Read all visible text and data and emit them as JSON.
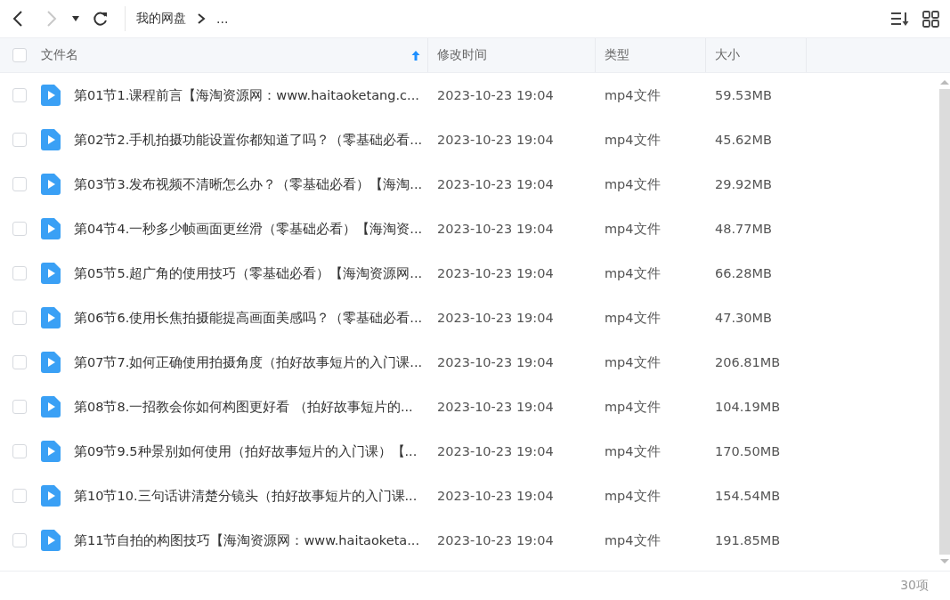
{
  "toolbar": {
    "back": {
      "disabled": false
    },
    "forward": {
      "disabled": true
    },
    "breadcrumb": [
      {
        "label": "我的网盘"
      },
      {
        "label": "..."
      }
    ]
  },
  "table": {
    "header_checkbox": {
      "checked": false
    },
    "columns": [
      {
        "label": "文件名",
        "sorted": true
      },
      {
        "label": "修改时间",
        "sorted": false
      },
      {
        "label": "类型",
        "sorted": false
      },
      {
        "label": "大小",
        "sorted": false
      }
    ],
    "rows": [
      {
        "checked": false,
        "name": "第01节1.课程前言【海淘资源网：www.haitaoketang.c...",
        "modified": "2023-10-23 19:04",
        "type": "mp4文件",
        "size": "59.53MB"
      },
      {
        "checked": false,
        "name": "第02节2.手机拍摄功能设置你都知道了吗？（零基础必看...",
        "modified": "2023-10-23 19:04",
        "type": "mp4文件",
        "size": "45.62MB"
      },
      {
        "checked": false,
        "name": "第03节3.发布视频不清晰怎么办？（零基础必看）【海淘...",
        "modified": "2023-10-23 19:04",
        "type": "mp4文件",
        "size": "29.92MB"
      },
      {
        "checked": false,
        "name": "第04节4.一秒多少帧画面更丝滑（零基础必看）【海淘资...",
        "modified": "2023-10-23 19:04",
        "type": "mp4文件",
        "size": "48.77MB"
      },
      {
        "checked": false,
        "name": "第05节5.超广角的使用技巧（零基础必看）【海淘资源网...",
        "modified": "2023-10-23 19:04",
        "type": "mp4文件",
        "size": "66.28MB"
      },
      {
        "checked": false,
        "name": "第06节6.使用长焦拍摄能提高画面美感吗？（零基础必看...",
        "modified": "2023-10-23 19:04",
        "type": "mp4文件",
        "size": "47.30MB"
      },
      {
        "checked": false,
        "name": "第07节7.如何正确使用拍摄角度（拍好故事短片的入门课...",
        "modified": "2023-10-23 19:04",
        "type": "mp4文件",
        "size": "206.81MB"
      },
      {
        "checked": false,
        "name": "第08节8.一招教会你如何构图更好看 （拍好故事短片的...",
        "modified": "2023-10-23 19:04",
        "type": "mp4文件",
        "size": "104.19MB"
      },
      {
        "checked": false,
        "name": "第09节9.5种景别如何使用（拍好故事短片的入门课）【...",
        "modified": "2023-10-23 19:04",
        "type": "mp4文件",
        "size": "170.50MB"
      },
      {
        "checked": false,
        "name": "第10节10.三句话讲清楚分镜头（拍好故事短片的入门课...",
        "modified": "2023-10-23 19:04",
        "type": "mp4文件",
        "size": "154.54MB"
      },
      {
        "checked": false,
        "name": "第11节自拍的构图技巧【海淘资源网：www.haitaoketa...",
        "modified": "2023-10-23 19:04",
        "type": "mp4文件",
        "size": "191.85MB"
      }
    ]
  },
  "status_bar": {
    "count": "30项"
  }
}
